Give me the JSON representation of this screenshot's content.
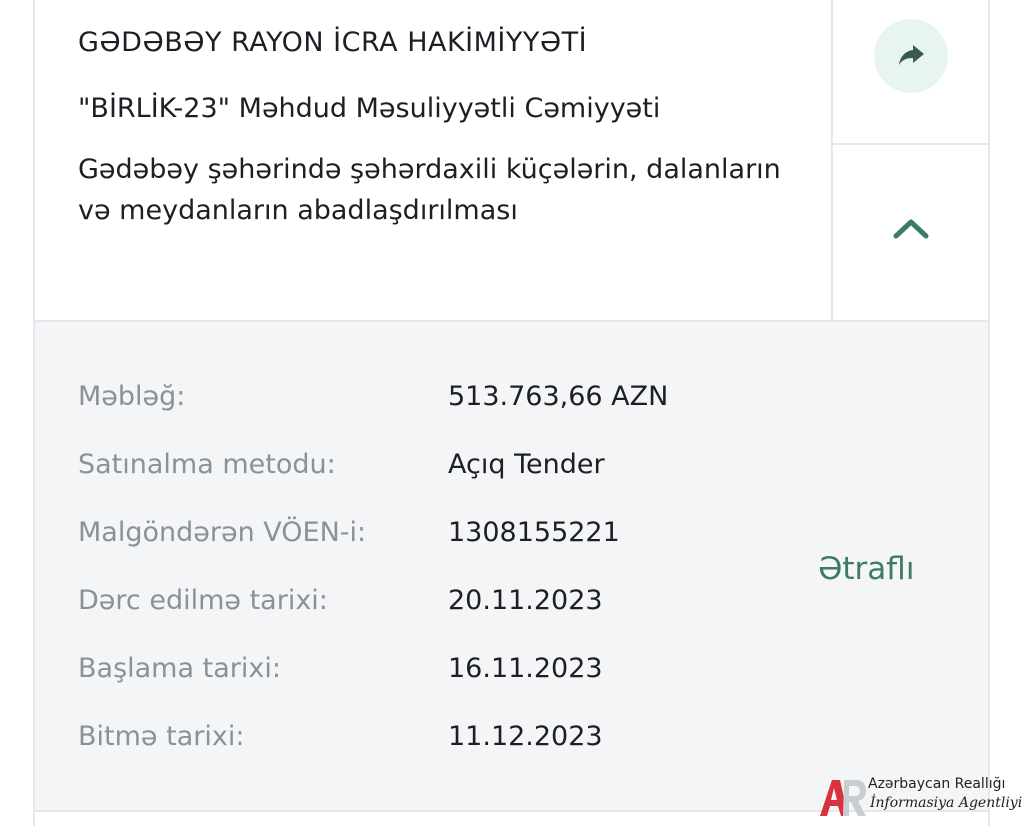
{
  "header": {
    "organization": "GƏDƏBƏY RAYON İCRA HAKİMİYYƏTİ",
    "company": "\"BİRLİK-23\" Məhdud Məsuliyyətli Cəmiyyəti",
    "subject": "Gədəbəy şəhərində şəhərdaxili küçələrin, dalanların və meydanların abadlaşdırılması"
  },
  "actions": {
    "share_icon": "share-arrow-icon",
    "collapse_icon": "chevron-up-icon"
  },
  "details": {
    "rows": [
      {
        "label": "Məbləğ:",
        "value": "513.763,66 AZN"
      },
      {
        "label": "Satınalma metodu:",
        "value": "Açıq Tender"
      },
      {
        "label": "Malgöndərən VÖEN-i:",
        "value": "1308155221"
      },
      {
        "label": "Dərc edilmə tarixi:",
        "value": "20.11.2023"
      },
      {
        "label": "Başlama tarixi:",
        "value": "16.11.2023"
      },
      {
        "label": "Bitmə tarixi:",
        "value": "11.12.2023"
      }
    ],
    "more_link": "Ətraflı"
  },
  "watermark": {
    "line1": "Azərbaycan Reallığı",
    "line2": "İnformasiya Agentliyi"
  },
  "colors": {
    "accent": "#3e7c62",
    "label": "#8b9199",
    "text": "#1c1f23",
    "details_bg": "#f4f5f6",
    "share_bg": "#e8f4f0"
  }
}
